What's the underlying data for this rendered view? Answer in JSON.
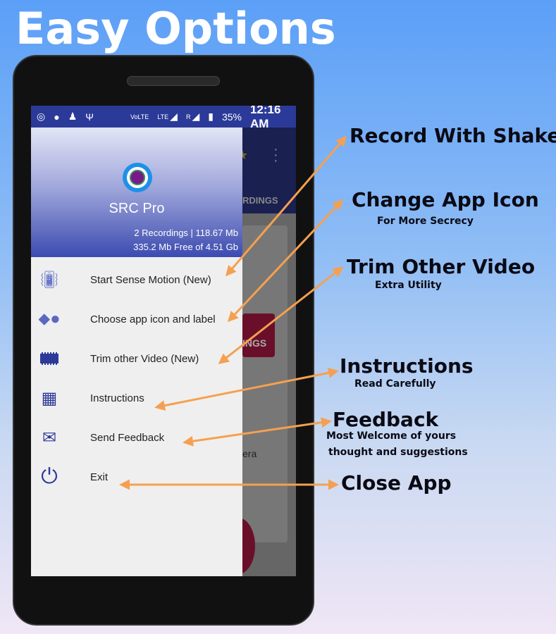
{
  "title": "Easy Options",
  "status_bar": {
    "volte": "VoLTE",
    "lte": "LTE",
    "roaming": "R",
    "battery": "35%",
    "time": "12:16 AM",
    "icons": [
      "hotspot-icon",
      "notification-icon",
      "android-icon",
      "usb-icon",
      "signal-icon",
      "battery-charging-icon"
    ]
  },
  "background_app": {
    "tab_partial": "RDINGS",
    "button_partial": "INGS",
    "card_partial": "era"
  },
  "drawer": {
    "app_name": "SRC Pro",
    "recordings": "2 Recordings | 118.67 Mb",
    "storage": "335.2 Mb Free of 4.51 Gb",
    "items": [
      {
        "label": "Start Sense Motion (New)",
        "icon": "phone-vibrate-icon"
      },
      {
        "label": "Choose app icon and label",
        "icon": "shapes-icon"
      },
      {
        "label": "Trim other Video (New)",
        "icon": "film-icon"
      },
      {
        "label": "Instructions",
        "icon": "instructions-icon"
      },
      {
        "label": "Send Feedback",
        "icon": "mail-upload-icon"
      },
      {
        "label": "Exit",
        "icon": "power-icon"
      }
    ]
  },
  "callouts": [
    {
      "title": "Record With Shake"
    },
    {
      "title": "Change App Icon",
      "sub": "For More Secrecy"
    },
    {
      "title": "Trim Other Video",
      "sub": "Extra Utility"
    },
    {
      "title": "Instructions",
      "sub": "Read Carefully"
    },
    {
      "title": "Feedback",
      "sub": "Most Welcome of yours",
      "sub2": "thought and suggestions"
    },
    {
      "title": "Close App"
    }
  ],
  "colors": {
    "arrow": "#f5a050",
    "status_bar": "#2b3a98",
    "icon": "#2e3a9a"
  }
}
